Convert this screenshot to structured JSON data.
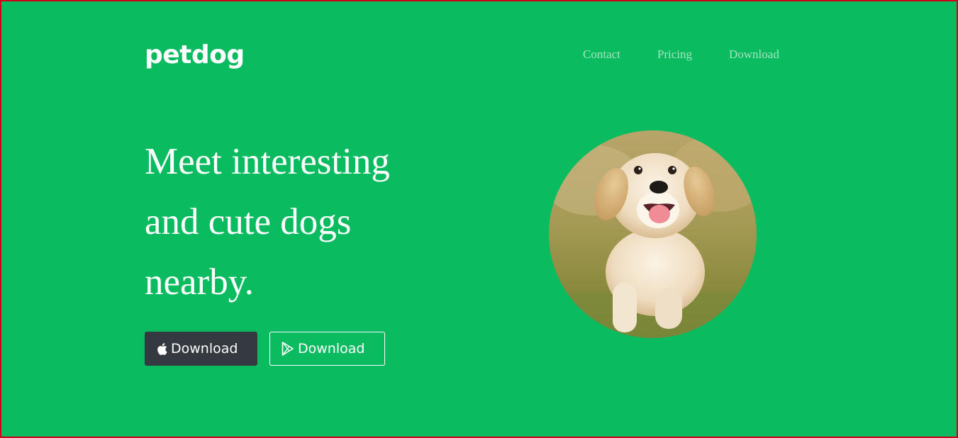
{
  "header": {
    "brand": "petdog",
    "nav": [
      {
        "label": "Contact"
      },
      {
        "label": "Pricing"
      },
      {
        "label": "Download"
      }
    ]
  },
  "hero": {
    "headline_lines": [
      "Meet interesting",
      "and cute dogs",
      "nearby."
    ],
    "buttons": {
      "ios_label": "Download",
      "ios_icon": "apple-icon",
      "android_label": "Download",
      "android_icon": "google-play-icon"
    },
    "image": {
      "subject": "puppy-photo"
    }
  },
  "colors": {
    "background": "#0bbb5f",
    "dark_button": "#343a40",
    "text": "#ffffff"
  }
}
